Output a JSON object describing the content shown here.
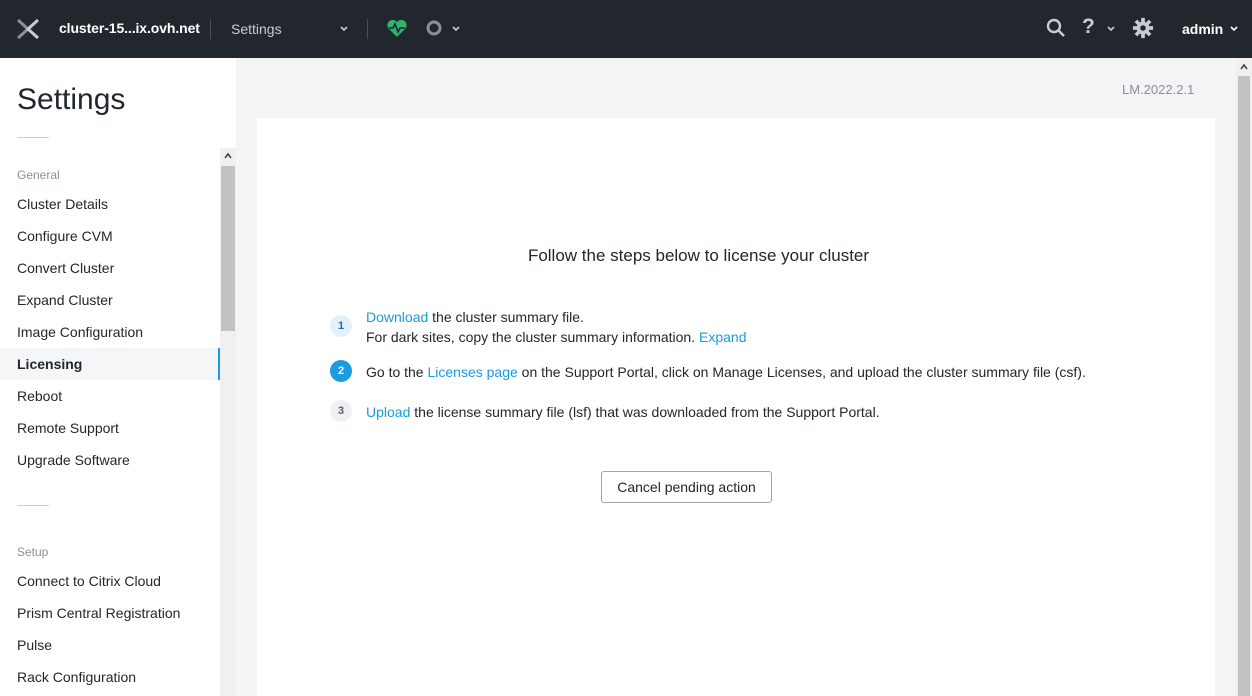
{
  "topbar": {
    "cluster_name": "cluster-15...ix.ovh.net",
    "section": "Settings",
    "help_symbol": "?",
    "user": "admin"
  },
  "sidebar": {
    "title": "Settings",
    "groups": [
      {
        "label": "General",
        "items": [
          "Cluster Details",
          "Configure CVM",
          "Convert Cluster",
          "Expand Cluster",
          "Image Configuration",
          "Licensing",
          "Reboot",
          "Remote Support",
          "Upgrade Software"
        ]
      },
      {
        "label": "Setup",
        "items": [
          "Connect to Citrix Cloud",
          "Prism Central Registration",
          "Pulse",
          "Rack Configuration"
        ]
      }
    ],
    "active_item": "Licensing"
  },
  "main": {
    "version": "LM.2022.2.1",
    "heading": "Follow the steps below to license your cluster",
    "steps": [
      {
        "number": "1",
        "link": "Download",
        "text": " the cluster summary file.",
        "line2": "For dark sites, copy the cluster summary information. ",
        "line2_link": "Expand"
      },
      {
        "number": "2",
        "pre": "Go to the ",
        "link": "Licenses page",
        "text": " on the Support Portal, click on Manage Licenses, and upload the cluster summary file (csf)."
      },
      {
        "number": "3",
        "link": "Upload",
        "text": " the license summary file (lsf) that was downloaded from the Support Portal."
      }
    ],
    "cancel_label": "Cancel pending action"
  },
  "colors": {
    "topbar": "#22272e",
    "accent": "#1b9be0",
    "health": "#2fb36f"
  }
}
